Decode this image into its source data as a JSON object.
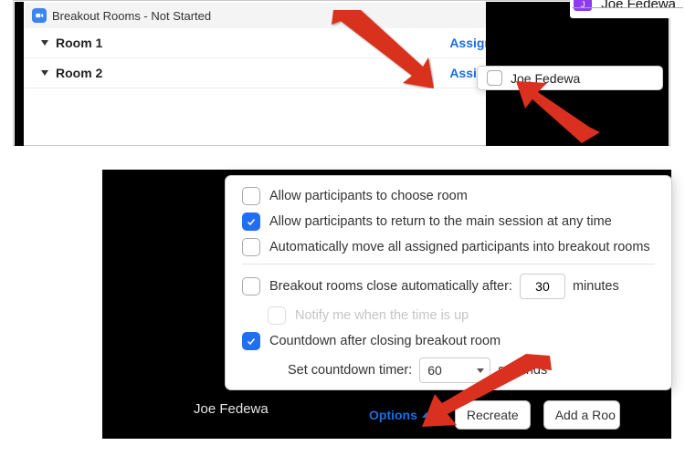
{
  "top": {
    "title": "Breakout Rooms - Not Started",
    "rooms": [
      {
        "name": "Room 1",
        "assign": "Assign"
      },
      {
        "name": "Room 2",
        "assign": "Assign"
      }
    ],
    "participant_name": "Joe Fedewa",
    "badge_name": "Joe Fedewa",
    "badge_initial": "J"
  },
  "options": {
    "choose_room": "Allow participants to choose room",
    "return_main": "Allow participants to return to the main session at any time",
    "auto_move": "Automatically move all assigned participants into breakout rooms",
    "auto_close_prefix": "Breakout rooms close automatically after:",
    "auto_close_minutes": "30",
    "auto_close_suffix": "minutes",
    "notify_time": "Notify me when the time is up",
    "countdown": "Countdown after closing breakout room",
    "countdown_label": "Set countdown timer:",
    "countdown_value": "60",
    "countdown_suffix": "seconds",
    "footer_name": "Joe Fedewa",
    "options_btn": "Options",
    "recreate_btn": "Recreate",
    "add_room_btn": "Add a Roo"
  }
}
